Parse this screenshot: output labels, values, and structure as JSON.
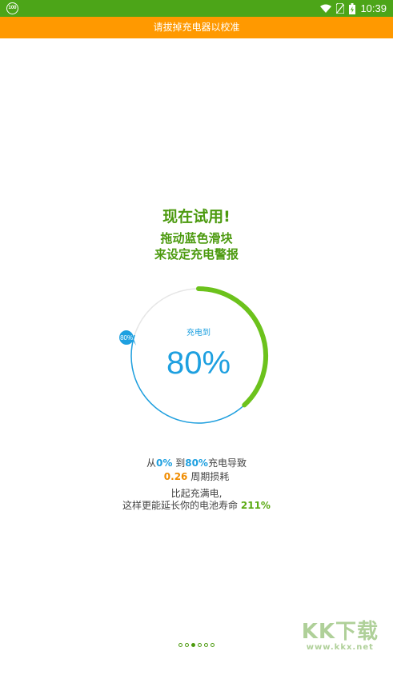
{
  "status_bar": {
    "badge_text": "100",
    "time": "10:39",
    "icons": [
      "wifi-icon",
      "no-sim-icon",
      "battery-charging-icon"
    ]
  },
  "banner": {
    "text": "请拔掉充电器以校准"
  },
  "intro": {
    "title": "现在试用!",
    "line1": "拖动蓝色滑块",
    "line2": "来设定充电警报"
  },
  "gauge": {
    "caption": "充电到",
    "value_text": "80%",
    "handle_label": "80%",
    "level": 0.8,
    "colors": {
      "track": "#e6e6e6",
      "blue": "#1ea0e0",
      "green": "#6cc21c"
    }
  },
  "info": {
    "from_prefix": "从",
    "from_value": "0%",
    "to_word": " 到",
    "to_value": "80%",
    "charge_suffix": "充电导致",
    "cycle_value": "0.26",
    "cycle_suffix": " 周期损耗",
    "compare_line": "比起充满电,",
    "extend_prefix": "这样更能延长你的电池寿命 ",
    "extend_value": "211%"
  },
  "pager": {
    "count": 6,
    "active_index": 2
  },
  "watermark": {
    "logo": "KK下载",
    "url": "www.kkx.net"
  }
}
